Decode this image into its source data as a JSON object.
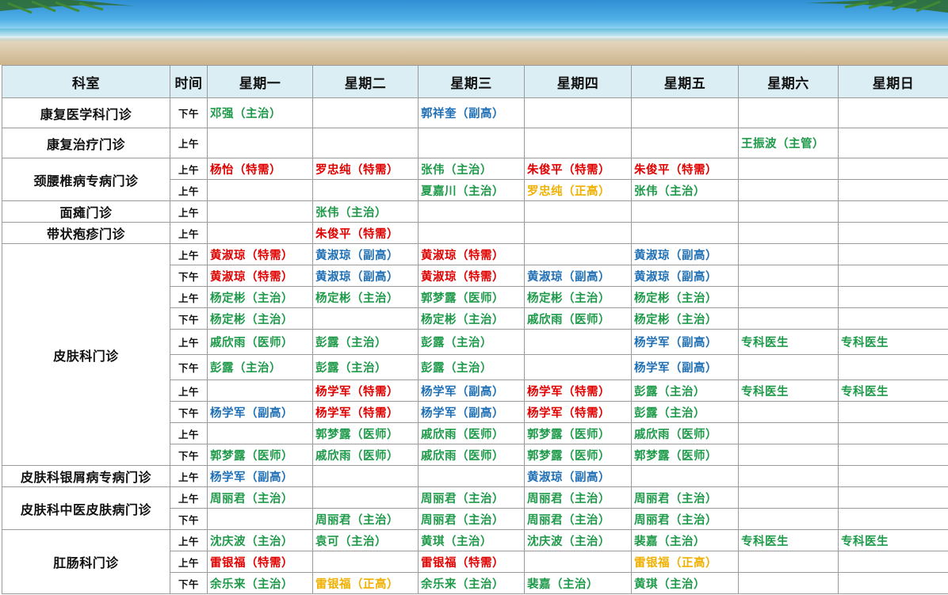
{
  "headers": [
    "科室",
    "时间",
    "星期一",
    "星期二",
    "星期三",
    "星期四",
    "星期五",
    "星期六",
    "星期日"
  ],
  "colors": {
    "green": "#1e9a4a",
    "red": "#e00000",
    "blue": "#1f6fb5",
    "yellow": "#f0b000"
  },
  "banner_icon": "palm-beach-banner",
  "departments": [
    {
      "name": "康复医学科门诊",
      "rows": [
        {
          "h": 38,
          "time": "下午",
          "cells": [
            {
              "t": "邓强（主治）",
              "c": "green"
            },
            {
              "t": "",
              "c": ""
            },
            {
              "t": "郭祥奎（副高）",
              "c": "blue"
            },
            {
              "t": "",
              "c": ""
            },
            {
              "t": "",
              "c": ""
            },
            {
              "t": "",
              "c": ""
            },
            {
              "t": "",
              "c": ""
            }
          ]
        }
      ]
    },
    {
      "name": "康复治疗门诊",
      "rows": [
        {
          "h": 38,
          "time": "上午",
          "cells": [
            {
              "t": "",
              "c": ""
            },
            {
              "t": "",
              "c": ""
            },
            {
              "t": "",
              "c": ""
            },
            {
              "t": "",
              "c": ""
            },
            {
              "t": "",
              "c": ""
            },
            {
              "t": "王振波（主管）",
              "c": "green"
            },
            {
              "t": "",
              "c": ""
            }
          ]
        }
      ]
    },
    {
      "name": "颈腰椎病专病门诊",
      "rows": [
        {
          "h": 27,
          "time": "上午",
          "cells": [
            {
              "t": "杨怡（特需）",
              "c": "red"
            },
            {
              "t": "罗忠纯（特需）",
              "c": "red"
            },
            {
              "t": "张伟（主治）",
              "c": "green"
            },
            {
              "t": "朱俊平（特需）",
              "c": "red"
            },
            {
              "t": "朱俊平（特需）",
              "c": "red"
            },
            {
              "t": "",
              "c": ""
            },
            {
              "t": "",
              "c": ""
            }
          ]
        },
        {
          "h": 27,
          "time": "上午",
          "cells": [
            {
              "t": "",
              "c": ""
            },
            {
              "t": "",
              "c": ""
            },
            {
              "t": "夏嘉川（主治）",
              "c": "green"
            },
            {
              "t": "罗忠纯（正高）",
              "c": "yellow"
            },
            {
              "t": "张伟（主治）",
              "c": "green"
            },
            {
              "t": "",
              "c": ""
            },
            {
              "t": "",
              "c": ""
            }
          ]
        }
      ]
    },
    {
      "name": "面瘫门诊",
      "rows": [
        {
          "h": 27,
          "time": "上午",
          "cells": [
            {
              "t": "",
              "c": ""
            },
            {
              "t": "张伟（主治）",
              "c": "green"
            },
            {
              "t": "",
              "c": ""
            },
            {
              "t": "",
              "c": ""
            },
            {
              "t": "",
              "c": ""
            },
            {
              "t": "",
              "c": ""
            },
            {
              "t": "",
              "c": ""
            }
          ]
        }
      ]
    },
    {
      "name": "带状疱疹门诊",
      "rows": [
        {
          "h": 27,
          "time": "上午",
          "cells": [
            {
              "t": "",
              "c": ""
            },
            {
              "t": "朱俊平（特需）",
              "c": "red"
            },
            {
              "t": "",
              "c": ""
            },
            {
              "t": "",
              "c": ""
            },
            {
              "t": "",
              "c": ""
            },
            {
              "t": "",
              "c": ""
            },
            {
              "t": "",
              "c": ""
            }
          ]
        }
      ]
    },
    {
      "name": "皮肤科门诊",
      "rows": [
        {
          "h": 27,
          "time": "上午",
          "cells": [
            {
              "t": "黄淑琼（特需）",
              "c": "red"
            },
            {
              "t": "黄淑琼（副高）",
              "c": "blue"
            },
            {
              "t": "黄淑琼（特需）",
              "c": "red"
            },
            {
              "t": "",
              "c": ""
            },
            {
              "t": "黄淑琼（副高）",
              "c": "blue"
            },
            {
              "t": "",
              "c": ""
            },
            {
              "t": "",
              "c": ""
            }
          ]
        },
        {
          "h": 27,
          "time": "下午",
          "cells": [
            {
              "t": "黄淑琼（特需）",
              "c": "red"
            },
            {
              "t": "黄淑琼（副高）",
              "c": "blue"
            },
            {
              "t": "黄淑琼（特需）",
              "c": "red"
            },
            {
              "t": "黄淑琼（副高）",
              "c": "blue"
            },
            {
              "t": "黄淑琼（副高）",
              "c": "blue"
            },
            {
              "t": "",
              "c": ""
            },
            {
              "t": "",
              "c": ""
            }
          ]
        },
        {
          "h": 27,
          "time": "上午",
          "cells": [
            {
              "t": "杨定彬（主治）",
              "c": "green"
            },
            {
              "t": "杨定彬（主治）",
              "c": "green"
            },
            {
              "t": "郭梦露（医师）",
              "c": "green"
            },
            {
              "t": "杨定彬（主治）",
              "c": "green"
            },
            {
              "t": "杨定彬（主治）",
              "c": "green"
            },
            {
              "t": "",
              "c": ""
            },
            {
              "t": "",
              "c": ""
            }
          ]
        },
        {
          "h": 27,
          "time": "下午",
          "cells": [
            {
              "t": "杨定彬（主治）",
              "c": "green"
            },
            {
              "t": "",
              "c": ""
            },
            {
              "t": "杨定彬（主治）",
              "c": "green"
            },
            {
              "t": "戚欣雨（医师）",
              "c": "green"
            },
            {
              "t": "杨定彬（主治）",
              "c": "green"
            },
            {
              "t": "",
              "c": ""
            },
            {
              "t": "",
              "c": ""
            }
          ]
        },
        {
          "h": 32,
          "time": "上午",
          "cells": [
            {
              "t": "戚欣雨（医师）",
              "c": "green"
            },
            {
              "t": "彭露（主治）",
              "c": "green"
            },
            {
              "t": "彭露（主治）",
              "c": "green"
            },
            {
              "t": "",
              "c": ""
            },
            {
              "t": "杨学军（副高）",
              "c": "blue"
            },
            {
              "t": "专科医生",
              "c": "green"
            },
            {
              "t": "专科医生",
              "c": "green"
            }
          ]
        },
        {
          "h": 32,
          "time": "下午",
          "cells": [
            {
              "t": "彭露（主治）",
              "c": "green"
            },
            {
              "t": "彭露（主治）",
              "c": "green"
            },
            {
              "t": "彭露（主治）",
              "c": "green"
            },
            {
              "t": "",
              "c": ""
            },
            {
              "t": "杨学军（副高）",
              "c": "blue"
            },
            {
              "t": "",
              "c": ""
            },
            {
              "t": "",
              "c": ""
            }
          ]
        },
        {
          "h": 27,
          "time": "上午",
          "cells": [
            {
              "t": "",
              "c": ""
            },
            {
              "t": "杨学军（特需）",
              "c": "red"
            },
            {
              "t": "杨学军（副高）",
              "c": "blue"
            },
            {
              "t": "杨学军（特需）",
              "c": "red"
            },
            {
              "t": "彭露（主治）",
              "c": "green"
            },
            {
              "t": "专科医生",
              "c": "green"
            },
            {
              "t": "专科医生",
              "c": "green"
            }
          ]
        },
        {
          "h": 27,
          "time": "下午",
          "cells": [
            {
              "t": "杨学军（副高）",
              "c": "blue"
            },
            {
              "t": "杨学军（特需）",
              "c": "red"
            },
            {
              "t": "杨学军（副高）",
              "c": "blue"
            },
            {
              "t": "杨学军（特需）",
              "c": "red"
            },
            {
              "t": "彭露（主治）",
              "c": "green"
            },
            {
              "t": "",
              "c": ""
            },
            {
              "t": "",
              "c": ""
            }
          ]
        },
        {
          "h": 27,
          "time": "上午",
          "cells": [
            {
              "t": "",
              "c": ""
            },
            {
              "t": "郭梦露（医师）",
              "c": "green"
            },
            {
              "t": "戚欣雨（医师）",
              "c": "green"
            },
            {
              "t": "郭梦露（医师）",
              "c": "green"
            },
            {
              "t": "戚欣雨（医师）",
              "c": "green"
            },
            {
              "t": "",
              "c": ""
            },
            {
              "t": "",
              "c": ""
            }
          ]
        },
        {
          "h": 27,
          "time": "下午",
          "cells": [
            {
              "t": "郭梦露（医师）",
              "c": "green"
            },
            {
              "t": "戚欣雨（医师）",
              "c": "green"
            },
            {
              "t": "戚欣雨（医师）",
              "c": "green"
            },
            {
              "t": "郭梦露（医师）",
              "c": "green"
            },
            {
              "t": "郭梦露（医师）",
              "c": "green"
            },
            {
              "t": "",
              "c": ""
            },
            {
              "t": "",
              "c": ""
            }
          ]
        }
      ]
    },
    {
      "name": "皮肤科银屑病专病门诊",
      "rows": [
        {
          "h": 27,
          "time": "上午",
          "cells": [
            {
              "t": "杨学军（副高）",
              "c": "blue"
            },
            {
              "t": "",
              "c": ""
            },
            {
              "t": "",
              "c": ""
            },
            {
              "t": "黄淑琼（副高）",
              "c": "blue"
            },
            {
              "t": "",
              "c": ""
            },
            {
              "t": "",
              "c": ""
            },
            {
              "t": "",
              "c": ""
            }
          ]
        }
      ]
    },
    {
      "name": "皮肤科中医皮肤病门诊",
      "rows": [
        {
          "h": 27,
          "time": "上午",
          "cells": [
            {
              "t": "周丽君（主治）",
              "c": "green"
            },
            {
              "t": "",
              "c": ""
            },
            {
              "t": "周丽君（主治）",
              "c": "green"
            },
            {
              "t": "周丽君（主治）",
              "c": "green"
            },
            {
              "t": "周丽君（主治）",
              "c": "green"
            },
            {
              "t": "",
              "c": ""
            },
            {
              "t": "",
              "c": ""
            }
          ]
        },
        {
          "h": 27,
          "time": "下午",
          "cells": [
            {
              "t": "",
              "c": ""
            },
            {
              "t": "周丽君（主治）",
              "c": "green"
            },
            {
              "t": "周丽君（主治）",
              "c": "green"
            },
            {
              "t": "周丽君（主治）",
              "c": "green"
            },
            {
              "t": "周丽君（主治）",
              "c": "green"
            },
            {
              "t": "",
              "c": ""
            },
            {
              "t": "",
              "c": ""
            }
          ]
        }
      ]
    },
    {
      "name": "肛肠科门诊",
      "rows": [
        {
          "h": 27,
          "time": "上午",
          "cells": [
            {
              "t": "沈庆波（主治）",
              "c": "green"
            },
            {
              "t": "袁可（主治）",
              "c": "green"
            },
            {
              "t": "黄琪（主治）",
              "c": "green"
            },
            {
              "t": "沈庆波（主治）",
              "c": "green"
            },
            {
              "t": "裴嘉（主治）",
              "c": "green"
            },
            {
              "t": "专科医生",
              "c": "green"
            },
            {
              "t": "专科医生",
              "c": "green"
            }
          ]
        },
        {
          "h": 27,
          "time": "上午",
          "cells": [
            {
              "t": "雷银福（特需）",
              "c": "red"
            },
            {
              "t": "",
              "c": ""
            },
            {
              "t": "雷银福（特需）",
              "c": "red"
            },
            {
              "t": "",
              "c": ""
            },
            {
              "t": "雷银福（正高）",
              "c": "yellow"
            },
            {
              "t": "",
              "c": ""
            },
            {
              "t": "",
              "c": ""
            }
          ]
        },
        {
          "h": 27,
          "time": "下午",
          "cells": [
            {
              "t": "余乐来（主治）",
              "c": "green"
            },
            {
              "t": "雷银福（正高）",
              "c": "yellow"
            },
            {
              "t": "余乐来（主治）",
              "c": "green"
            },
            {
              "t": "裴嘉（主治）",
              "c": "green"
            },
            {
              "t": "黄琪（主治）",
              "c": "green"
            },
            {
              "t": "",
              "c": ""
            },
            {
              "t": "",
              "c": ""
            }
          ]
        }
      ]
    }
  ]
}
